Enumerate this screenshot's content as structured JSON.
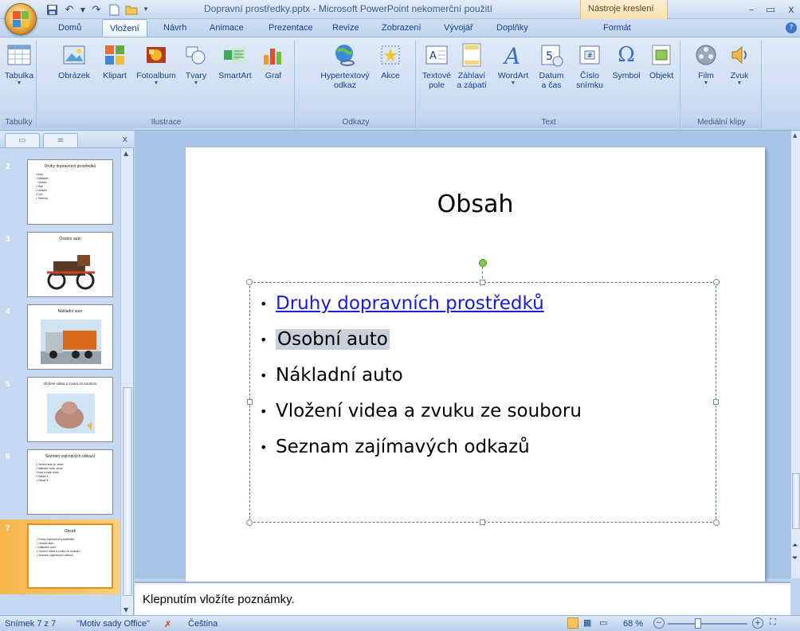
{
  "window": {
    "title": "Dopravní prostředky.pptx - Microsoft PowerPoint nekomerční použití",
    "contextual_title": "Nástroje kreslení"
  },
  "tabs": [
    {
      "label": "Domů"
    },
    {
      "label": "Vložení",
      "active": true
    },
    {
      "label": "Návrh"
    },
    {
      "label": "Animace"
    },
    {
      "label": "Prezentace"
    },
    {
      "label": "Revize"
    },
    {
      "label": "Zobrazení"
    },
    {
      "label": "Vývojář"
    },
    {
      "label": "Doplňky"
    },
    {
      "label": "Formát"
    }
  ],
  "ribbon": {
    "groups": {
      "tabulky": "Tabulky",
      "ilustrace": "Ilustrace",
      "odkazy": "Odkazy",
      "text": "Text",
      "media": "Mediální klipy"
    },
    "buttons": {
      "tabulka": "Tabulka",
      "obrazek": "Obrázek",
      "klipart": "Klipart",
      "fotoalbum": "Fotoalbum",
      "tvary": "Tvary",
      "smartart": "SmartArt",
      "graf": "Graf",
      "hypertext1": "Hypertextový",
      "hypertext2": "odkaz",
      "akce": "Akce",
      "textove1": "Textové",
      "textove2": "pole",
      "zahlavi1": "Záhlaví",
      "zahlavi2": "a zápatí",
      "wordart": "WordArt",
      "datum1": "Datum",
      "datum2": "a čas",
      "cislo1": "Číslo",
      "cislo2": "snímku",
      "symbol": "Symbol",
      "objekt": "Objekt",
      "film": "Film",
      "zvuk": "Zvuk"
    }
  },
  "thumbnails": [
    {
      "num": "2",
      "title": "Druhy dopravních prostředků",
      "bullets": [
        "• Auto",
        "   - Nákladní",
        "   - Osobní",
        "• Vlak",
        "• Letadlo",
        "• Loď",
        "• Tramvaj"
      ]
    },
    {
      "num": "3",
      "title": "Osobní auto"
    },
    {
      "num": "4",
      "title": "Nákladní auto"
    },
    {
      "num": "5",
      "title": "Vložení videa a zvuku ze souboru"
    },
    {
      "num": "6",
      "title": "Seznam zajímavých odkazů",
      "bullets": [
        "• Osobní auto je: www",
        "• Nákladní auto: www",
        "• Auto a vlak: www",
        "• Odkaz 4",
        "• Odkaz 5"
      ]
    },
    {
      "num": "7",
      "title": "Obsah",
      "bullets": [
        "• Druhy dopravních prostředků",
        "• Osobní auto",
        "• Nákladní auto",
        "• Vložení videa a zvuku ze souboru",
        "• Seznam zajímavých odkazů"
      ]
    }
  ],
  "slide": {
    "title": "Obsah",
    "bullets": [
      "Druhy dopravních prostředků",
      "Osobní auto",
      "Nákladní auto",
      "Vložení videa a zvuku ze souboru",
      "Seznam zajímavých odkazů"
    ]
  },
  "notes": {
    "placeholder": "Klepnutím vložíte poznámky."
  },
  "status": {
    "slide": "Snímek 7 z 7",
    "theme": "\"Motiv sady Office\"",
    "language": "Čeština",
    "zoom": "68 %"
  },
  "colors": {
    "accent": "#15428b",
    "selected_thumb": "#f7b54b",
    "hyperlink": "#1a1adc"
  }
}
